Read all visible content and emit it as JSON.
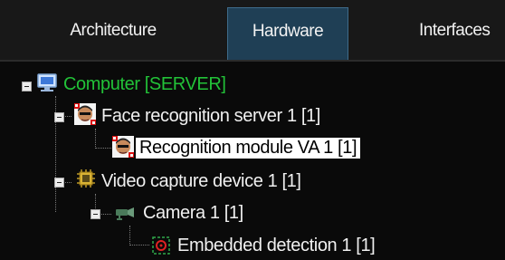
{
  "tabs": [
    {
      "label": "Architecture",
      "selected": false
    },
    {
      "label": "Hardware",
      "selected": true
    },
    {
      "label": "Interfaces",
      "selected": false
    }
  ],
  "tree": {
    "nodes": [
      {
        "label": "Computer [SERVER]",
        "icon": "computer-icon",
        "color": "#22c238",
        "expanded": true
      },
      {
        "label": "Face recognition server 1 [1]",
        "icon": "face-recognition-icon",
        "expanded": true
      },
      {
        "label": "Recognition module VA 1 [1]",
        "icon": "face-recognition-icon",
        "selected": true
      },
      {
        "label": "Video capture device 1 [1]",
        "icon": "video-capture-device-icon",
        "expanded": true
      },
      {
        "label": "Camera 1 [1]",
        "icon": "camera-icon",
        "expanded": true
      },
      {
        "label": "Embedded detection 1 [1]",
        "icon": "embedded-detection-icon"
      }
    ]
  },
  "colors": {
    "background": "#0a0a0a",
    "tab_selected": "#1f3f55",
    "computer_label": "#22c238",
    "selection": "#ffffff"
  }
}
